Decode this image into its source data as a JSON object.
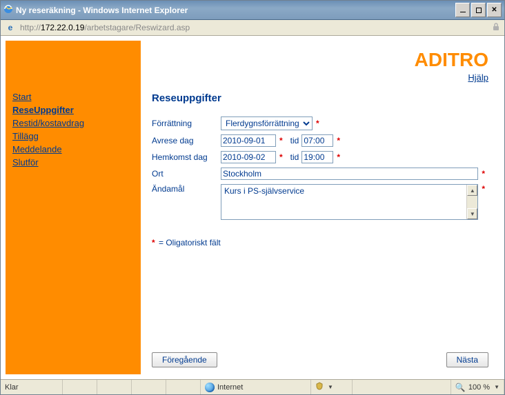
{
  "window": {
    "title": "Ny reseräkning - Windows Internet Explorer",
    "url_prefix": "http://",
    "url_ip": "172.22.0.19",
    "url_path": "/arbetstagare/Reswizard.asp"
  },
  "sidebar": {
    "items": [
      {
        "label": "Start",
        "active": false
      },
      {
        "label": "ReseUppgifter",
        "active": true
      },
      {
        "label": "Restid/kostavdrag",
        "active": false
      },
      {
        "label": "Tillägg",
        "active": false
      },
      {
        "label": "Meddelande",
        "active": false
      },
      {
        "label": "Slutför",
        "active": false
      }
    ]
  },
  "brand": "ADITRO",
  "help": "Hjälp",
  "section_title": "Reseuppgifter",
  "form": {
    "forrattning_label": "Förrättning",
    "forrattning_value": "Flerdygnsförrättning",
    "avrese_label": "Avrese dag",
    "avrese_date": "2010-09-01",
    "tid_label": "tid",
    "avrese_time": "07:00",
    "hemkomst_label": "Hemkomst dag",
    "hemkomst_date": "2010-09-02",
    "hemkomst_time": "19:00",
    "ort_label": "Ort",
    "ort_value": "Stockholm",
    "andamal_label": "Ändamål",
    "andamal_value": "Kurs i PS-självservice"
  },
  "hint": {
    "asterisk": "*",
    "text": " = Oligatoriskt fält"
  },
  "buttons": {
    "prev": "Föregående",
    "next": "Nästa"
  },
  "status": {
    "ready": "Klar",
    "zone": "Internet",
    "zoom": "100 %"
  }
}
